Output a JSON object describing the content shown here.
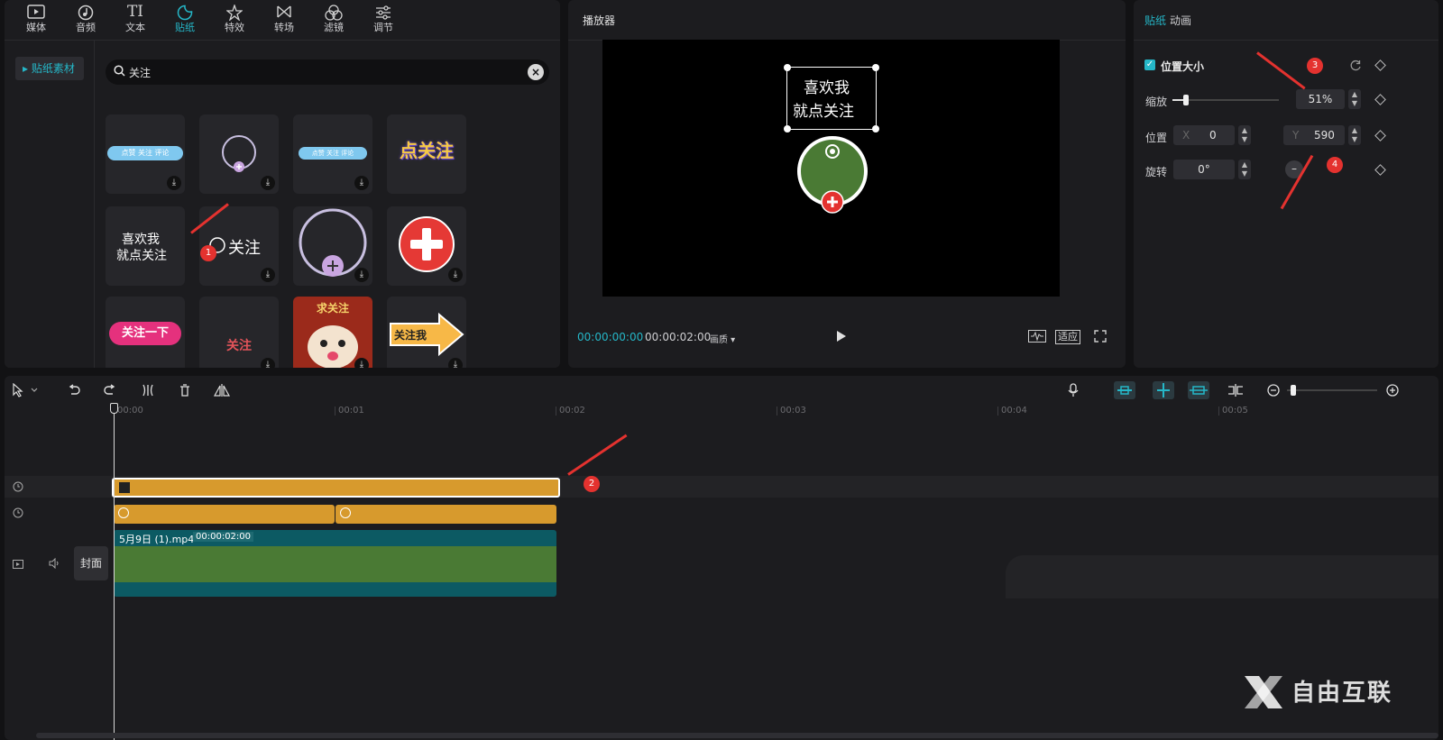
{
  "media_tabs": [
    {
      "label": "媒体",
      "icon": "media-icon"
    },
    {
      "label": "音频",
      "icon": "audio-icon"
    },
    {
      "label": "文本",
      "icon": "text-icon"
    },
    {
      "label": "贴纸",
      "icon": "sticker-icon",
      "active": true
    },
    {
      "label": "特效",
      "icon": "effects-icon"
    },
    {
      "label": "转场",
      "icon": "transition-icon"
    },
    {
      "label": "滤镜",
      "icon": "filter-icon"
    },
    {
      "label": "调节",
      "icon": "adjust-icon"
    }
  ],
  "sidebar": {
    "item": "▸ 贴纸素材"
  },
  "search": {
    "value": "关注"
  },
  "stickers": {
    "t1": "点赞 关注 评论",
    "t3": "点赞 关注 评论",
    "t4": "点关注",
    "t5a": "喜欢我",
    "t5b": "就点关注",
    "t6": "关注",
    "t9": "关注一下",
    "t10": "关注",
    "t11": "求关注",
    "t12": "关注我"
  },
  "player": {
    "title": "播放器",
    "current_time": "00:00:00:00",
    "duration": "00:00:02:00",
    "quality": "画质 ▾",
    "fit_label": "适应",
    "overlay_line1": "喜欢我",
    "overlay_line2": "就点关注"
  },
  "props": {
    "tabs": [
      "贴纸",
      "动画"
    ],
    "section": "位置大小",
    "scale_label": "缩放",
    "scale_value": "51%",
    "position_label": "位置",
    "x_label": "X",
    "x_value": "0",
    "y_label": "Y",
    "y_value": "590",
    "rotate_label": "旋转",
    "rotate_value": "0°"
  },
  "timeline": {
    "ticks": [
      "00:00",
      "00:01",
      "00:02",
      "00:03",
      "00:04",
      "00:05"
    ],
    "video_clip_name": "5月9日 (1).mp4",
    "video_clip_duration": "00:00:02:00",
    "cover_label": "封面"
  },
  "annotations": [
    "1",
    "2",
    "3",
    "4"
  ],
  "watermark": "自由互联",
  "colors": {
    "accent": "#25b7c8",
    "clip_orange": "#d79a2d",
    "clip_teal": "#0c5a63",
    "clip_green": "#4a7a34",
    "annotation_red": "#e4322f"
  }
}
